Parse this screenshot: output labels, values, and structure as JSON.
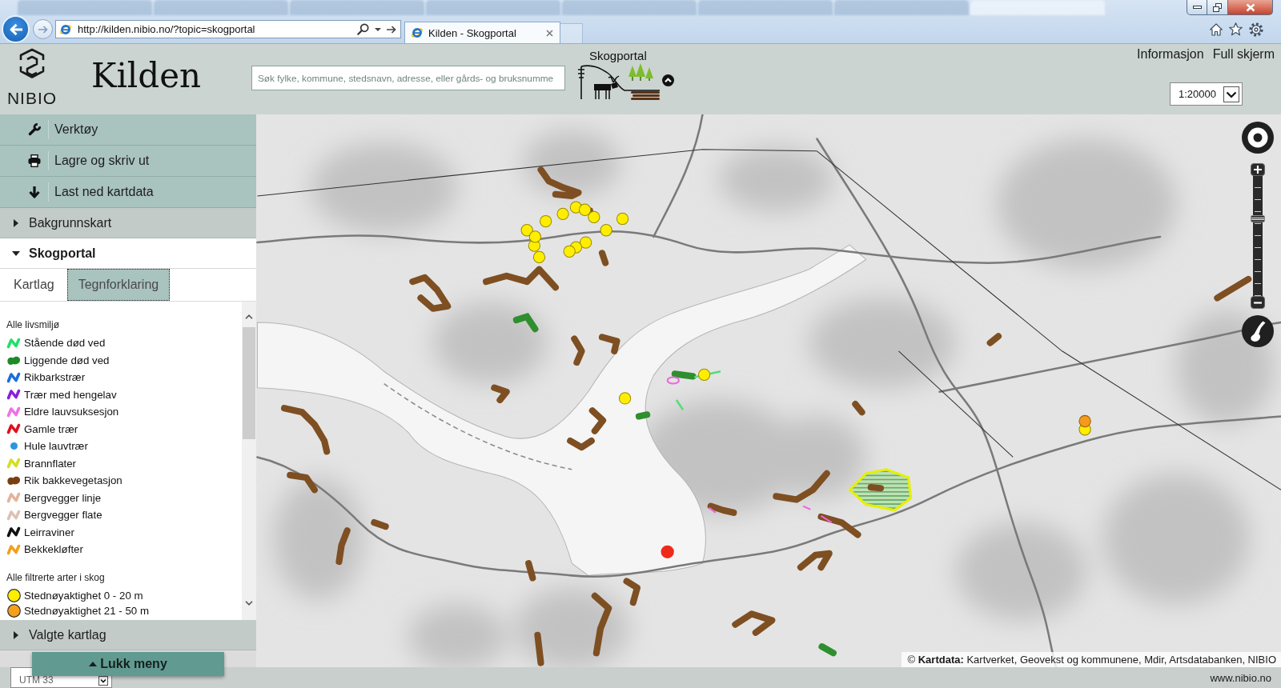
{
  "browser": {
    "background_tabs": [
      {
        "selected": false
      },
      {
        "selected": false
      },
      {
        "selected": false
      },
      {
        "selected": false
      },
      {
        "selected": false
      },
      {
        "selected": false
      },
      {
        "selected": false
      },
      {
        "selected": true
      }
    ],
    "address": {
      "url": "http://kilden.nibio.no/?topic=skogportal"
    },
    "tabs": [
      {
        "title": "Kilden - Skogportal",
        "selected": true
      }
    ]
  },
  "header": {
    "logo_text": "NIBIO",
    "app_title": "Kilden",
    "search": {
      "placeholder": "Søk fylke, kommune, stedsnavn, adresse, eller gårds- og bruksnumme"
    },
    "topic": {
      "title": "Skogportal"
    },
    "links": [
      "Informasjon",
      "Full skjerm"
    ],
    "scale": {
      "value": "1:20000"
    }
  },
  "sidebar": {
    "tools": [
      {
        "label": "Verktøy"
      },
      {
        "label": "Lagre og skriv ut"
      },
      {
        "label": "Last ned kartdata"
      }
    ],
    "sections": [
      {
        "label": "Bakgrunnskart",
        "expanded": false
      },
      {
        "label": "Skogportal",
        "expanded": true,
        "tabs": [
          {
            "label": "Kartlag",
            "selected": false
          },
          {
            "label": "Tegnforklaring",
            "selected": true
          }
        ],
        "legend": {
          "groups": [
            {
              "heading": "Alle livsmiljø",
              "items": [
                {
                  "label": "Stående død ved",
                  "kind": "line",
                  "color": "#22e06a"
                },
                {
                  "label": "Liggende død ved",
                  "kind": "area",
                  "color": "#1d8a26"
                },
                {
                  "label": "Rikbarkstrær",
                  "kind": "line",
                  "color": "#1a6ee0"
                },
                {
                  "label": "Trær med hengelav",
                  "kind": "line",
                  "color": "#8b1fd8"
                },
                {
                  "label": "Eldre lauvsuksesjon",
                  "kind": "line",
                  "color": "#ee72e6"
                },
                {
                  "label": "Gamle trær",
                  "kind": "line",
                  "color": "#e0101e"
                },
                {
                  "label": "Hule lauvtrær",
                  "kind": "point",
                  "color": "#2a96e0"
                },
                {
                  "label": "Brannflater",
                  "kind": "line",
                  "color": "#d2e021"
                },
                {
                  "label": "Rik bakkevegetasjon",
                  "kind": "area",
                  "color": "#7a3f10"
                },
                {
                  "label": "Bergvegger linje",
                  "kind": "line",
                  "color": "#e2b49a"
                },
                {
                  "label": "Bergvegger flate",
                  "kind": "line",
                  "color": "#dcc2b4"
                },
                {
                  "label": "Leirraviner",
                  "kind": "line",
                  "color": "#111111"
                },
                {
                  "label": "Bekkekløfter",
                  "kind": "line",
                  "color": "#f0a11c"
                }
              ]
            },
            {
              "heading": "Alle filtrerte arter i skog",
              "items": [
                {
                  "label": "Stednøyaktighet 0 - 20 m",
                  "kind": "circle",
                  "color": "#ffee00"
                },
                {
                  "label": "Stednøyaktighet 21 - 50 m",
                  "kind": "circle",
                  "color": "#f5a01a"
                }
              ]
            }
          ]
        }
      },
      {
        "label": "Valgte kartlag",
        "expanded": false
      }
    ],
    "close_button": {
      "label": "Lukk meny"
    }
  },
  "map": {
    "zoom": {
      "level": 0.65
    },
    "attribution": "© **Kartdata:** Kartverket, Geovekst og kommunene, Mdir, Artsdatabanken, NIBIO"
  },
  "footer": {
    "projection": {
      "value": "UTM 33"
    },
    "link": "www.nibio.no"
  }
}
